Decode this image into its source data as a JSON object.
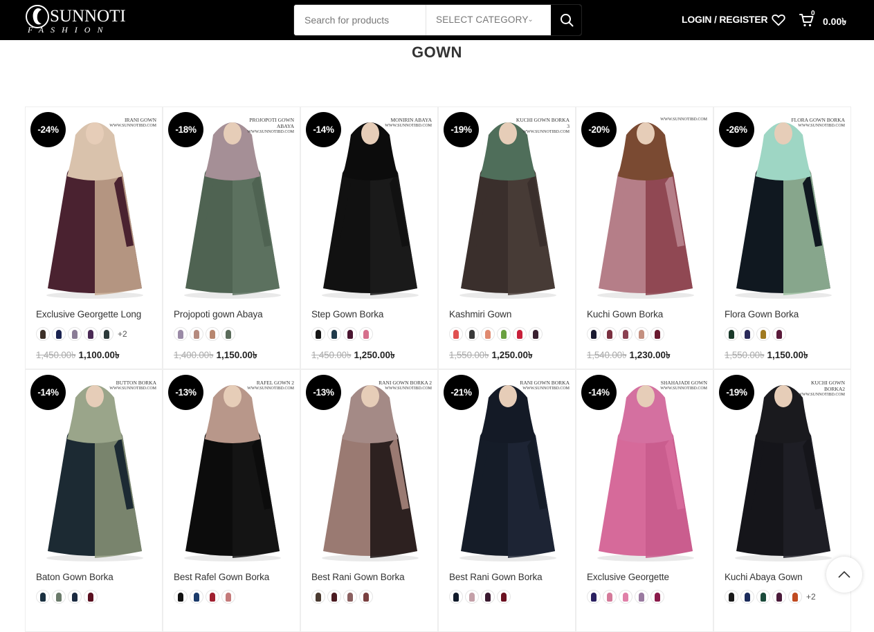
{
  "header": {
    "brand_name": "SUNNOTI",
    "brand_sub": "FASHION",
    "search_placeholder": "Search for products",
    "category_label": "SELECT CATEGORY",
    "login_label": "LOGIN / REGISTER",
    "cart_count": "0",
    "cart_total": "0.00৳"
  },
  "page_title": "GOWN",
  "products": [
    {
      "name": "Exclusive Georgette Long",
      "discount": "-24%",
      "tag": "IRANI GOWN",
      "site": "WWW.SUNNOTIBD.COM",
      "old_price": "1,450.00৳",
      "price": "1,100.00৳",
      "swatches": [
        "#3d3028",
        "#1a2350",
        "#8a7c96",
        "#4a2a55",
        "#2c3a3a"
      ],
      "more": "+2",
      "dress": "#4a2230",
      "dress2": "#c7a98f",
      "scarf": "#d9c2ac"
    },
    {
      "name": "Projopoti gown Abaya",
      "discount": "-18%",
      "tag": "PROJOPOTI GOWN ABAYA",
      "site": "WWW.SUNNOTIBD.COM",
      "old_price": "1,400.00৳",
      "price": "1,150.00৳",
      "swatches": [
        "#9a8aa6",
        "#b58a7e",
        "#b7866f",
        "#5a6b5a"
      ],
      "more": "",
      "dress": "#4f6352",
      "dress2": "#5e7361",
      "scarf": "#a58f96"
    },
    {
      "name": "Step Gown Borka",
      "discount": "-14%",
      "tag": "MONIRIN ABAYA",
      "site": "WWW.SUNNOTIBD.COM",
      "old_price": "1,450.00৳",
      "price": "1,250.00৳",
      "swatches": [
        "#151515",
        "#1f3a4a",
        "#4a1530",
        "#d66f8c"
      ],
      "more": "",
      "dress": "#111111",
      "dress2": "#1c1c1c",
      "scarf": "#0c0c0c"
    },
    {
      "name": "Kashmiri Gown",
      "discount": "-19%",
      "tag": "KUCHI GOWN BORKA 3",
      "site": "WWW.SUNNOTIBD.COM",
      "old_price": "1,550.00৳",
      "price": "1,250.00৳",
      "swatches": [
        "#e05050",
        "#3a3a3a",
        "#e08a70",
        "#6aa040",
        "#c8203a",
        "#3a2030"
      ],
      "more": "",
      "dress": "#3a2f2c",
      "dress2": "#4a3d38",
      "scarf": "#4f6e5a"
    },
    {
      "name": "Kuchi Gown Borka",
      "discount": "-20%",
      "tag": "",
      "site": "WWW.SUNNOTIBD.COM",
      "old_price": "1,540.00৳",
      "price": "1,230.00৳",
      "swatches": [
        "#1a1a30",
        "#7a3040",
        "#8a4050",
        "#c49080",
        "#6a1a30"
      ],
      "more": "",
      "dress": "#b57e88",
      "dress2": "#8a3e4a",
      "scarf": "#7a4a32"
    },
    {
      "name": "Flora Gown Borka",
      "discount": "-26%",
      "tag": "FLORA GOWN BORKA",
      "site": "WWW.SUNNOTIBD.COM",
      "old_price": "1,550.00৳",
      "price": "1,150.00৳",
      "swatches": [
        "#1a3a2a",
        "#2a2a5a",
        "#a07a20",
        "#5a1a3a"
      ],
      "more": "",
      "dress": "#101820",
      "dress2": "#9cc0a0",
      "scarf": "#9ed6c4"
    },
    {
      "name": "Baton Gown Borka",
      "discount": "-14%",
      "tag": "BUTTON BORKA",
      "site": "WWW.SUNNOTIBD.COM",
      "old_price": "",
      "price": "",
      "swatches": [
        "#1a3040",
        "#6a7a6a",
        "#1a2a40",
        "#5a1020"
      ],
      "more": "",
      "dress": "#1c2a33",
      "dress2": "#8a9478",
      "scarf": "#9aa58a"
    },
    {
      "name": "Best Rafel Gown Borka",
      "discount": "-13%",
      "tag": "RAFEL GOWN 2",
      "site": "WWW.SUNNOTIBD.COM",
      "old_price": "",
      "price": "",
      "swatches": [
        "#111111",
        "#1a3a6a",
        "#a02030",
        "#c47a7a"
      ],
      "more": "",
      "dress": "#0c0c0c",
      "dress2": "#161616",
      "scarf": "#b8978a"
    },
    {
      "name": "Best Rani Gown Borka",
      "discount": "-13%",
      "tag": "RANI GOWN BORKA 2",
      "site": "WWW.SUNNOTIBD.COM",
      "old_price": "",
      "price": "",
      "swatches": [
        "#4a3a30",
        "#4a1a20",
        "#8a6060",
        "#7a4040"
      ],
      "more": "",
      "dress": "#9a7a72",
      "dress2": "#1a1212",
      "scarf": "#a48a86"
    },
    {
      "name": "Best Rani Gown Borka",
      "discount": "-21%",
      "tag": "RANI GOWN BORKA",
      "site": "WWW.SUNNOTIBD.COM",
      "old_price": "",
      "price": "",
      "swatches": [
        "#101a2a",
        "#c4a0a8",
        "#3a1a30",
        "#6a1020"
      ],
      "more": "",
      "dress": "#151c28",
      "dress2": "#1f2636",
      "scarf": "#141a26"
    },
    {
      "name": "Exclusive Georgette",
      "discount": "-14%",
      "tag": "SHAHAJADI GOWN",
      "site": "WWW.SUNNOTIBD.COM",
      "old_price": "",
      "price": "",
      "swatches": [
        "#2a2060",
        "#d47a9a",
        "#e080a8",
        "#9a7aa0",
        "#8a1a4a"
      ],
      "more": "",
      "dress": "#d66a9a",
      "dress2": "#c85a8c",
      "scarf": "#d470a0"
    },
    {
      "name": "Kuchi Abaya Gown",
      "discount": "-19%",
      "tag": "KUCHI GOWN BORKA2",
      "site": "WWW.SUNNOTIBD.COM",
      "old_price": "",
      "price": "",
      "swatches": [
        "#1a1a1a",
        "#1a2a5a",
        "#1a4a3a",
        "#4a1a3a",
        "#c04a20"
      ],
      "more": "+2",
      "dress": "#15151a",
      "dress2": "#202028",
      "scarf": "#1a1a1e"
    }
  ]
}
